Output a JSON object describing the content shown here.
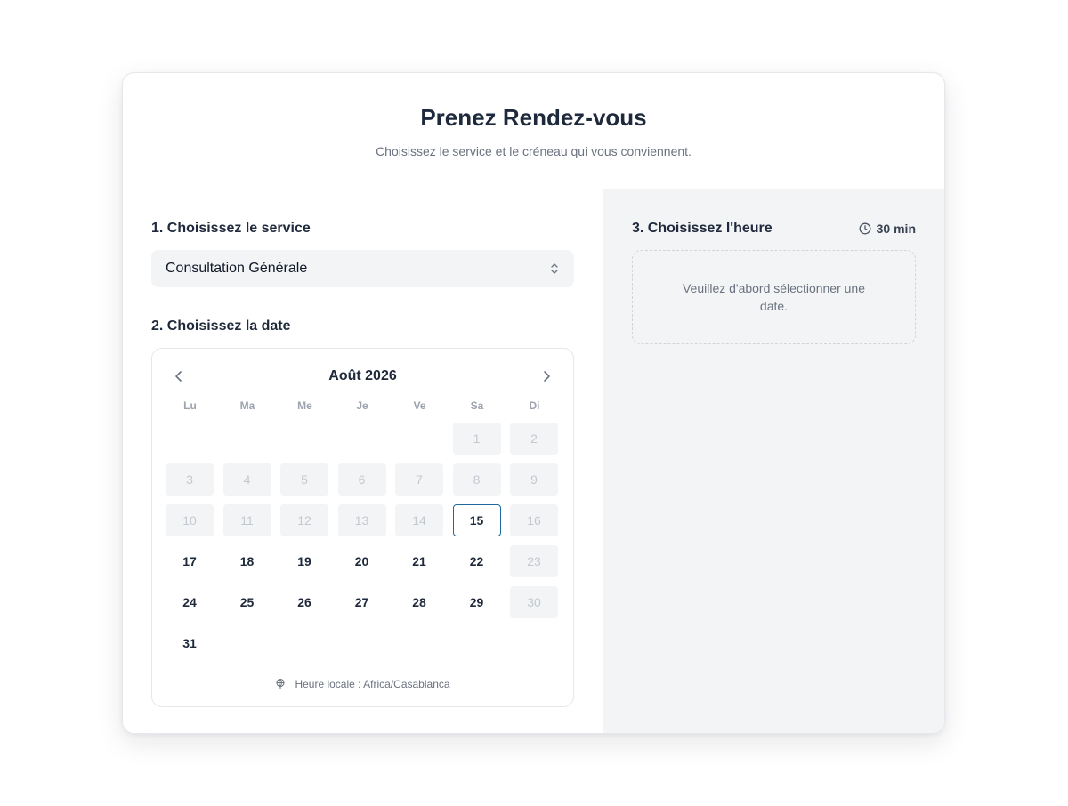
{
  "header": {
    "title": "Prenez Rendez-vous",
    "subtitle": "Choisissez le service et le créneau qui vous conviennent."
  },
  "service": {
    "label": "1. Choisissez le service",
    "selected": "Consultation Générale"
  },
  "date": {
    "label": "2. Choisissez la date",
    "month": "Août 2026",
    "weekdays": [
      "Lu",
      "Ma",
      "Me",
      "Je",
      "Ve",
      "Sa",
      "Di"
    ],
    "leading_blanks": 5,
    "days": [
      {
        "n": "1",
        "state": "disabled"
      },
      {
        "n": "2",
        "state": "disabled"
      },
      {
        "n": "3",
        "state": "disabled"
      },
      {
        "n": "4",
        "state": "disabled"
      },
      {
        "n": "5",
        "state": "disabled"
      },
      {
        "n": "6",
        "state": "disabled"
      },
      {
        "n": "7",
        "state": "disabled"
      },
      {
        "n": "8",
        "state": "disabled"
      },
      {
        "n": "9",
        "state": "disabled"
      },
      {
        "n": "10",
        "state": "disabled"
      },
      {
        "n": "11",
        "state": "disabled"
      },
      {
        "n": "12",
        "state": "disabled"
      },
      {
        "n": "13",
        "state": "disabled"
      },
      {
        "n": "14",
        "state": "disabled"
      },
      {
        "n": "15",
        "state": "today"
      },
      {
        "n": "16",
        "state": "disabled"
      },
      {
        "n": "17",
        "state": "available"
      },
      {
        "n": "18",
        "state": "available"
      },
      {
        "n": "19",
        "state": "available"
      },
      {
        "n": "20",
        "state": "available"
      },
      {
        "n": "21",
        "state": "available"
      },
      {
        "n": "22",
        "state": "available"
      },
      {
        "n": "23",
        "state": "disabled"
      },
      {
        "n": "24",
        "state": "available"
      },
      {
        "n": "25",
        "state": "available"
      },
      {
        "n": "26",
        "state": "available"
      },
      {
        "n": "27",
        "state": "available"
      },
      {
        "n": "28",
        "state": "available"
      },
      {
        "n": "29",
        "state": "available"
      },
      {
        "n": "30",
        "state": "disabled"
      },
      {
        "n": "31",
        "state": "available"
      }
    ],
    "timezone": "Heure locale : Africa/Casablanca"
  },
  "time": {
    "label": "3. Choisissez l'heure",
    "duration": "30 min",
    "placeholder": "Veuillez d'abord sélectionner une date."
  },
  "colors": {
    "accent": "#1e6a9e",
    "text": "#1e293b",
    "muted": "#6b7280",
    "disabled_bg": "#f3f4f6"
  },
  "icons": {
    "prev": "chevron-left-icon",
    "next": "chevron-right-icon",
    "select": "chevron-up-down-icon",
    "clock": "clock-icon",
    "globe": "globe-icon"
  }
}
